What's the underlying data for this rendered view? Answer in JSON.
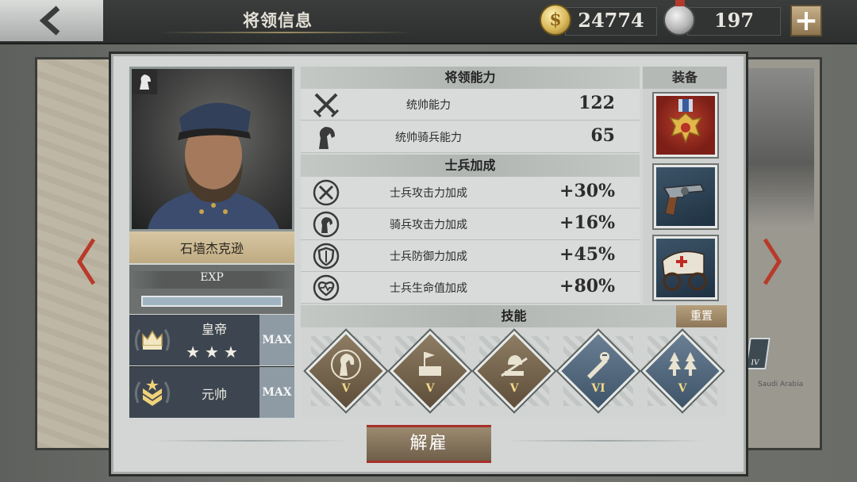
{
  "header": {
    "title": "将领信息",
    "gold": "24774",
    "medals": "197",
    "add_label": "+"
  },
  "general": {
    "name": "石墙杰克逊",
    "exp_label": "EXP",
    "exp_progress": 1.0,
    "rank1": {
      "title": "皇帝",
      "stars": "★★★",
      "star_count": 3,
      "max_label": "MAX"
    },
    "rank2": {
      "title": "元帅",
      "max_label": "MAX"
    }
  },
  "abilities": {
    "heading": "将领能力",
    "rows": [
      {
        "label": "统帅能力",
        "value": "122",
        "icon": "crossed-swords-icon"
      },
      {
        "label": "统帅骑兵能力",
        "value": "65",
        "icon": "horse-icon"
      }
    ]
  },
  "bonuses": {
    "heading": "士兵加成",
    "rows": [
      {
        "label": "士兵攻击力加成",
        "value": "+30%",
        "icon": "attack-up-icon"
      },
      {
        "label": "骑兵攻击力加成",
        "value": "+16%",
        "icon": "cavalry-attack-up-icon"
      },
      {
        "label": "士兵防御力加成",
        "value": "+45%",
        "icon": "defense-up-icon"
      },
      {
        "label": "士兵生命值加成",
        "value": "+80%",
        "icon": "health-up-icon"
      }
    ]
  },
  "equipment": {
    "heading": "装备",
    "items": [
      "medal-icon",
      "revolver-icon",
      "ambulance-cart-icon"
    ]
  },
  "skills": {
    "heading": "技能",
    "reset_label": "重置",
    "items": [
      {
        "icon": "horse-skill-icon",
        "level": "V"
      },
      {
        "icon": "fortification-skill-icon",
        "level": "V"
      },
      {
        "icon": "infantry-skill-icon",
        "level": "V"
      },
      {
        "icon": "medic-skill-icon",
        "level": "VI"
      },
      {
        "icon": "forest-skill-icon",
        "level": "V"
      }
    ]
  },
  "actions": {
    "fire_label": "解雇"
  },
  "map": {
    "label": "Saudi Arabia",
    "badge": "IV"
  },
  "colors": {
    "gold": "#d9b85a",
    "name_plate": "#c9b68e",
    "rank_bg": "#3d4650",
    "fire_border": "#a8302a"
  }
}
